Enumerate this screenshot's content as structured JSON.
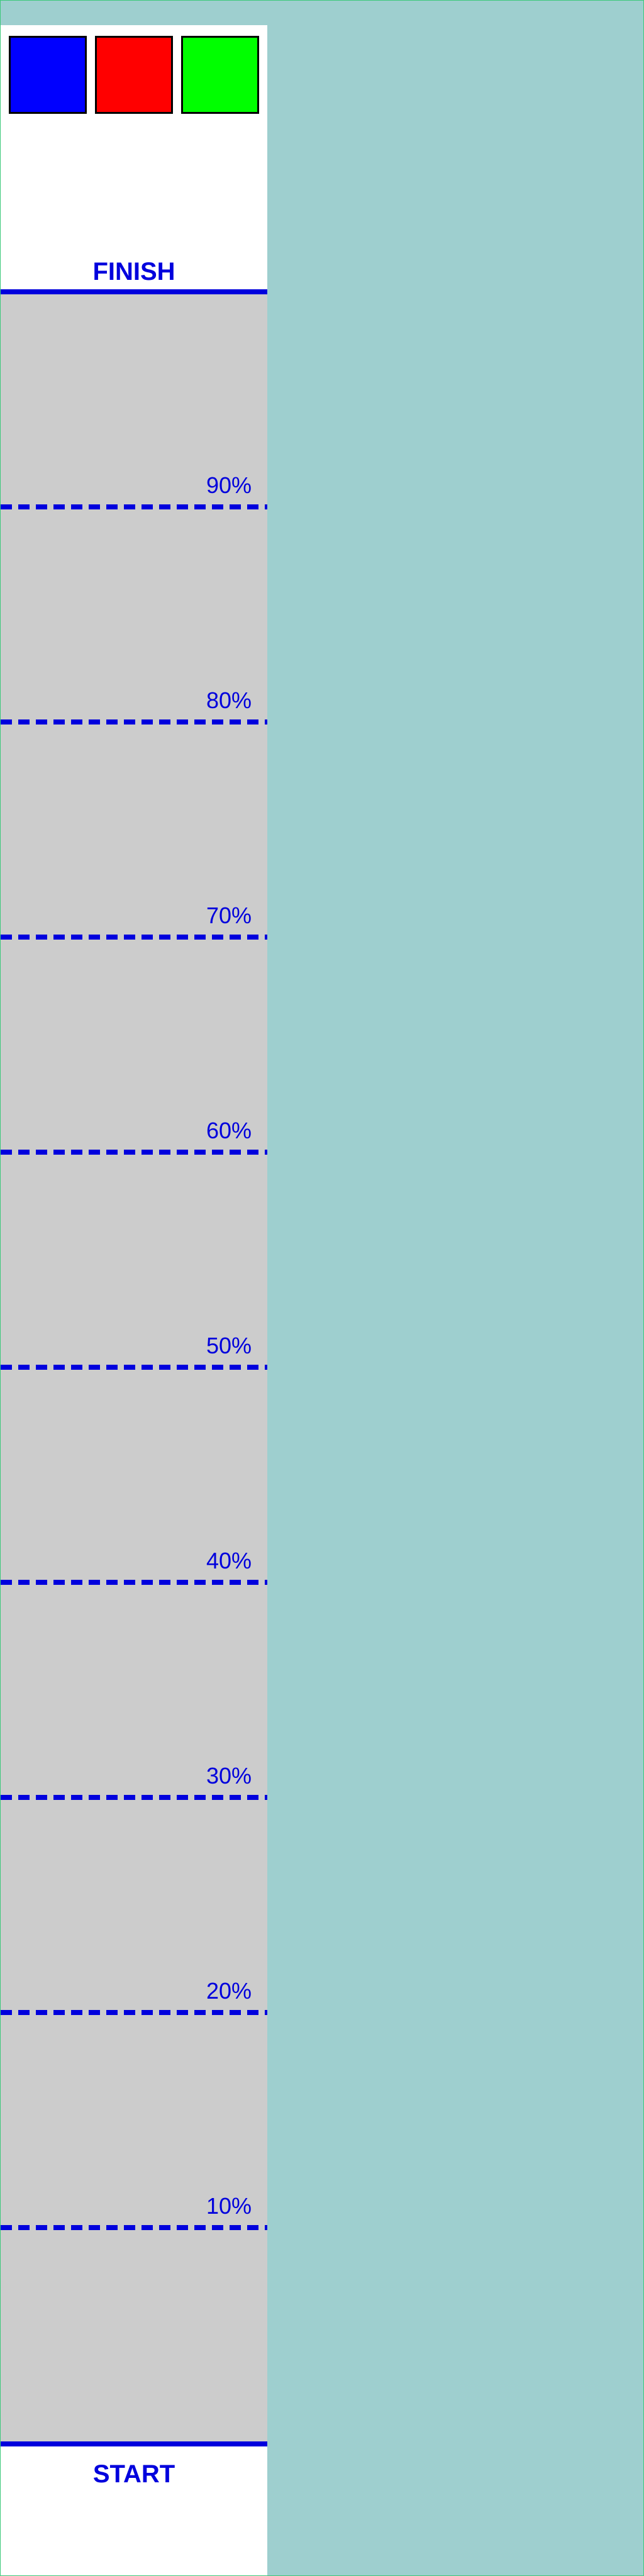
{
  "colors": {
    "background": "#9ecfcf",
    "panel": "#ffffff",
    "track": "#cccccc",
    "line": "#0000dd",
    "border": "#3cc97a"
  },
  "swatches": [
    {
      "name": "blue",
      "color": "#0000ff"
    },
    {
      "name": "red",
      "color": "#ff0000"
    },
    {
      "name": "green",
      "color": "#00ff00"
    }
  ],
  "finish_label": "FINISH",
  "start_label": "START",
  "markers": [
    "90%",
    "80%",
    "70%",
    "60%",
    "50%",
    "40%",
    "30%",
    "20%",
    "10%"
  ]
}
